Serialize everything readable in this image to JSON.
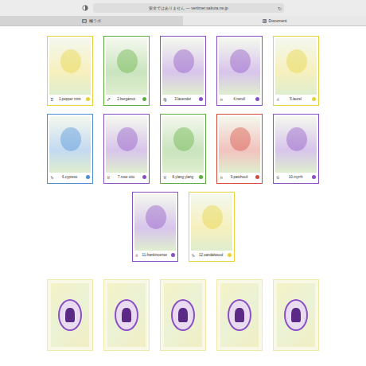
{
  "browser": {
    "address": "安全ではありません — vertimer.sakura.ne.jp",
    "reload": "↻"
  },
  "tabs": [
    {
      "label": "極ラボ",
      "icon": "極",
      "selected": false
    },
    {
      "label": "Document",
      "icon": "D",
      "selected": true
    }
  ],
  "cards": [
    {
      "name": "1.pepper mint",
      "sign": "♊",
      "color": "#e6d23a"
    },
    {
      "name": "2.bergamot",
      "sign": "♐",
      "color": "#5fae3c"
    },
    {
      "name": "3.lavender",
      "sign": "♍",
      "color": "#8a4fc4"
    },
    {
      "name": "4.neroli",
      "sign": "♎",
      "color": "#8a4fc4"
    },
    {
      "name": "5.laurel",
      "sign": "♌",
      "color": "#e6d23a"
    },
    {
      "name": "6.cypress",
      "sign": "♑",
      "color": "#4a8fd6"
    },
    {
      "name": "7.rose otto",
      "sign": "♉",
      "color": "#8a4fc4"
    },
    {
      "name": "8.ylang ylang",
      "sign": "♉",
      "color": "#5fae3c"
    },
    {
      "name": "9.patchouli",
      "sign": "♎",
      "color": "#d64a3c"
    },
    {
      "name": "10.myrrh",
      "sign": "♋",
      "color": "#8a4fc4"
    },
    {
      "name": "11.frankincense",
      "sign": "♌",
      "color": "#8a4fc4"
    },
    {
      "name": "12.sandalwood",
      "sign": "♑",
      "color": "#e6d23a"
    }
  ],
  "card_backs": [
    {
      "face_down": true
    },
    {
      "face_down": true
    },
    {
      "face_down": true
    },
    {
      "face_down": true
    },
    {
      "face_down": true
    }
  ]
}
